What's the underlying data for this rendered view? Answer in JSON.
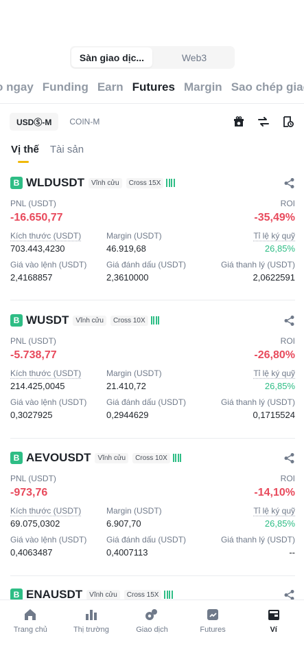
{
  "top_toggle": {
    "exchange": "Sàn giao dịc...",
    "web3": "Web3"
  },
  "main_tabs": [
    "o ngay",
    "Funding",
    "Earn",
    "Futures",
    "Margin",
    "Sao chép giao"
  ],
  "sub_tabs": {
    "usdm": "USDⓈ-M",
    "coinm": "COIN-M"
  },
  "position_tabs": {
    "positions": "Vị thế",
    "assets": "Tài sản"
  },
  "labels": {
    "pnl": "PNL (USDT)",
    "roi": "ROI",
    "size": "Kích thước (USDT)",
    "margin": "Margin (USDT)",
    "margin_ratio": "Tỉ lệ ký quỹ",
    "entry": "Giá vào lệnh (USDT)",
    "mark": "Giá đánh dấu (USDT)",
    "liq": "Giá thanh lý (USDT)"
  },
  "positions": [
    {
      "badge": "B",
      "symbol": "WLDUSDT",
      "type": "Vĩnh cửu",
      "leverage": "Cross 15X",
      "pnl": "-16.650,77",
      "roi": "-35,49%",
      "size": "703.443,4230",
      "margin": "46.919,68",
      "margin_ratio": "26,85%",
      "entry": "2,4168857",
      "mark": "2,3610000",
      "liq": "2,0622591"
    },
    {
      "badge": "B",
      "symbol": "WUSDT",
      "type": "Vĩnh cửu",
      "leverage": "Cross 10X",
      "pnl": "-5.738,77",
      "roi": "-26,80%",
      "size": "214.425,0045",
      "margin": "21.410,72",
      "margin_ratio": "26,85%",
      "entry": "0,3027925",
      "mark": "0,2944629",
      "liq": "0,1715524"
    },
    {
      "badge": "B",
      "symbol": "AEVOUSDT",
      "type": "Vĩnh cửu",
      "leverage": "Cross 10X",
      "pnl": "-973,76",
      "roi": "-14,10%",
      "size": "69.075,0302",
      "margin": "6.907,70",
      "margin_ratio": "26,85%",
      "entry": "0,4063487",
      "mark": "0,4007113",
      "liq": "--"
    },
    {
      "badge": "B",
      "symbol": "ENAUSDT",
      "type": "Vĩnh cửu",
      "leverage": "Cross 15X"
    }
  ],
  "nav": [
    "Trang chủ",
    "Thị trường",
    "Giao dịch",
    "Futures",
    "Ví"
  ],
  "colors": {
    "accent": "#f0b90b",
    "green": "#2ebd85",
    "red": "#e84a5c"
  }
}
